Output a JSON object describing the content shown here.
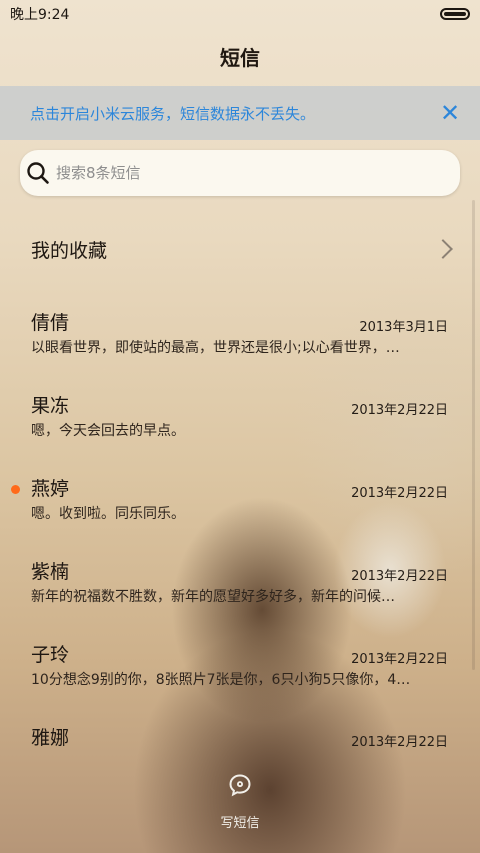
{
  "status_bar": {
    "time": "晚上9:24",
    "battery_icon": "battery-icon"
  },
  "header": {
    "title": "短信"
  },
  "banner": {
    "text": "点击开启小米云服务，短信数据永不丢失。",
    "close_icon": "close-icon",
    "accent_color": "#2c86da"
  },
  "search": {
    "placeholder": "搜索8条短信",
    "icon": "search-icon"
  },
  "favorites": {
    "label": "我的收藏",
    "chevron_icon": "chevron-right-icon"
  },
  "conversations": [
    {
      "name": "倩倩",
      "date": "2013年3月1日",
      "preview": "以眼看世界，即使站的最高，世界还是很小;以心看世界，…",
      "unread": false
    },
    {
      "name": "果冻",
      "date": "2013年2月22日",
      "preview": "嗯，今天会回去的早点。",
      "unread": false
    },
    {
      "name": "燕婷",
      "date": "2013年2月22日",
      "preview": "嗯。收到啦。同乐同乐。",
      "unread": true
    },
    {
      "name": "紫楠",
      "date": "2013年2月22日",
      "preview": "新年的祝福数不胜数，新年的愿望好多好多，新年的问候…",
      "unread": false
    },
    {
      "name": "子玲",
      "date": "2013年2月22日",
      "preview": "10分想念9别的你，8张照片7张是你，6只小狗5只像你，4…",
      "unread": false
    },
    {
      "name": "雅娜",
      "date": "2013年2月22日",
      "preview": "",
      "unread": false
    }
  ],
  "compose": {
    "label": "写短信",
    "icon": "compose-message-icon"
  },
  "colors": {
    "unread_dot": "#ff6a1a"
  }
}
